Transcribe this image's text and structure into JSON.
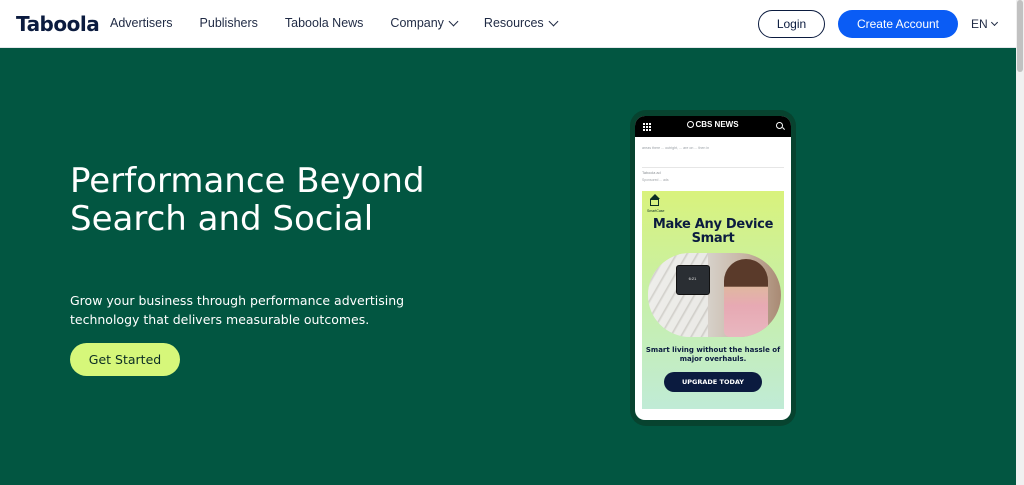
{
  "header": {
    "logo": "Taboola",
    "nav": [
      {
        "label": "Advertisers"
      },
      {
        "label": "Publishers"
      },
      {
        "label": "Taboola News"
      },
      {
        "label": "Company"
      },
      {
        "label": "Resources"
      }
    ],
    "login_label": "Login",
    "create_account_label": "Create Account",
    "language": "EN"
  },
  "hero": {
    "title": "Performance Beyond Search and Social",
    "subtitle": "Grow your business through performance advertising technology that delivers measurable outcomes.",
    "cta_label": "Get Started"
  },
  "phone": {
    "site_name": "CBS NEWS",
    "article_snippet": "areas there ... outright, ... are on ... then in",
    "sponsor": "Taboola ad",
    "sponsor_sub": "Sponsored ... ads",
    "ad": {
      "brand": "SmartCase",
      "title": "Make Any Device Smart",
      "tablet_text": "6:21",
      "copy": "Smart living without the hassle of major overhauls.",
      "button_label": "UPGRADE TODAY"
    }
  },
  "colors": {
    "hero_bg": "#025641",
    "cta_bg": "#d6f77a",
    "primary_button": "#0a5cf5",
    "navy": "#0b1b3f"
  }
}
